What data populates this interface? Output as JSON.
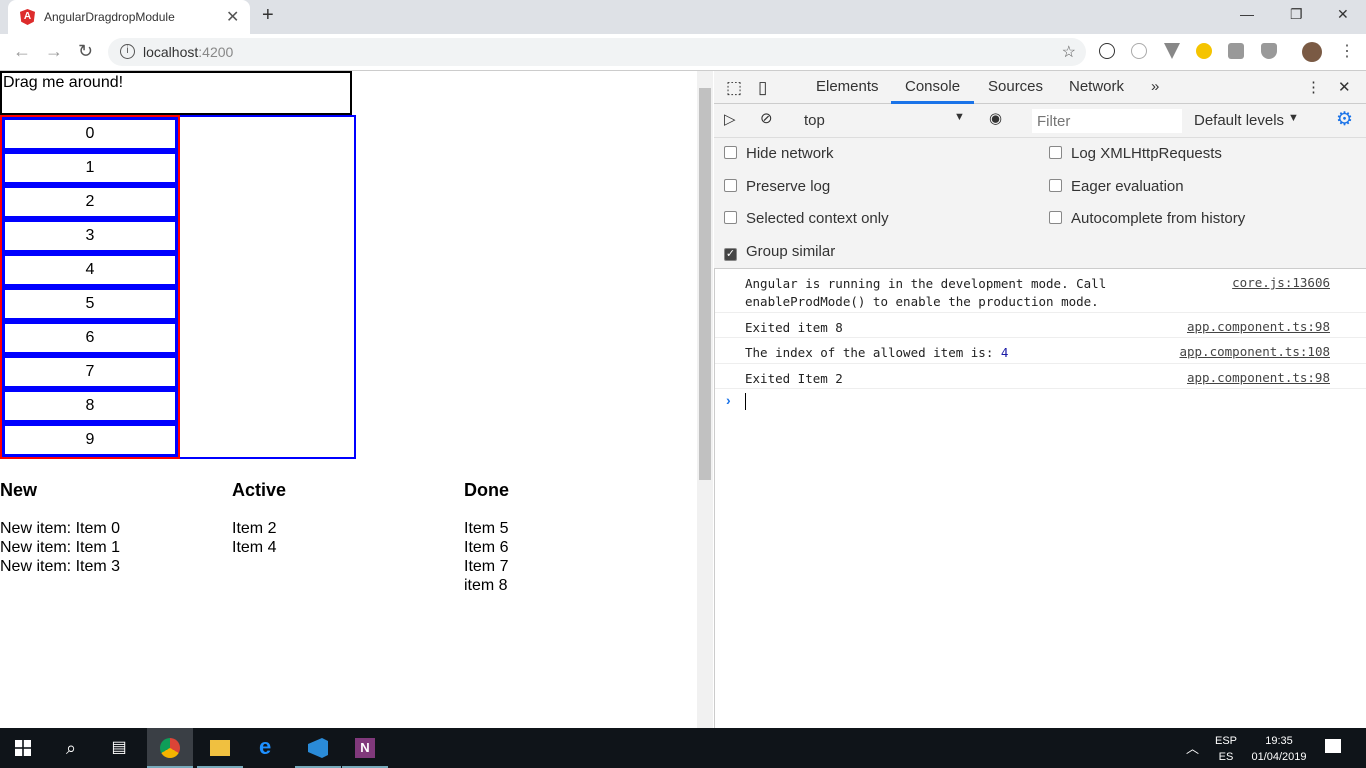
{
  "browser": {
    "tab_title": "AngularDragdropModule",
    "url_host": "localhost",
    "url_port": ":4200"
  },
  "page": {
    "drag_label": "Drag me around!",
    "numbers": [
      "0",
      "1",
      "2",
      "3",
      "4",
      "5",
      "6",
      "7",
      "8",
      "9"
    ],
    "columns": [
      {
        "title": "New",
        "items": [
          "New item: Item 0",
          "New item: Item 1",
          "New item: Item 3"
        ]
      },
      {
        "title": "Active",
        "items": [
          "Item 2",
          "Item 4"
        ]
      },
      {
        "title": "Done",
        "items": [
          "Item 5",
          "Item 6",
          "Item 7",
          "item 8"
        ]
      }
    ]
  },
  "devtools": {
    "tabs": [
      "Elements",
      "Console",
      "Sources",
      "Network"
    ],
    "active_tab": "Console",
    "context": "top",
    "filter_placeholder": "Filter",
    "levels": "Default levels",
    "settings_left": [
      {
        "label": "Hide network",
        "checked": false
      },
      {
        "label": "Preserve log",
        "checked": false
      },
      {
        "label": "Selected context only",
        "checked": false
      },
      {
        "label": "Group similar",
        "checked": true
      }
    ],
    "settings_right": [
      {
        "label": "Log XMLHttpRequests",
        "checked": false
      },
      {
        "label": "Eager evaluation",
        "checked": false
      },
      {
        "label": "Autocomplete from history",
        "checked": false
      }
    ],
    "logs": [
      {
        "message": "Angular is running in the development mode. Call\nenableProdMode() to enable the production mode.",
        "source": "core.js:13606"
      },
      {
        "message": "Exited item 8",
        "source": "app.component.ts:98"
      },
      {
        "message": "The index of the allowed item is: ",
        "value": "4",
        "source": "app.component.ts:108"
      },
      {
        "message": "Exited Item 2",
        "source": "app.component.ts:98"
      }
    ],
    "accent": "#1a73e8"
  },
  "taskbar": {
    "lang_top": "ESP",
    "lang_bottom": "ES",
    "time": "19:35",
    "date": "01/04/2019"
  }
}
